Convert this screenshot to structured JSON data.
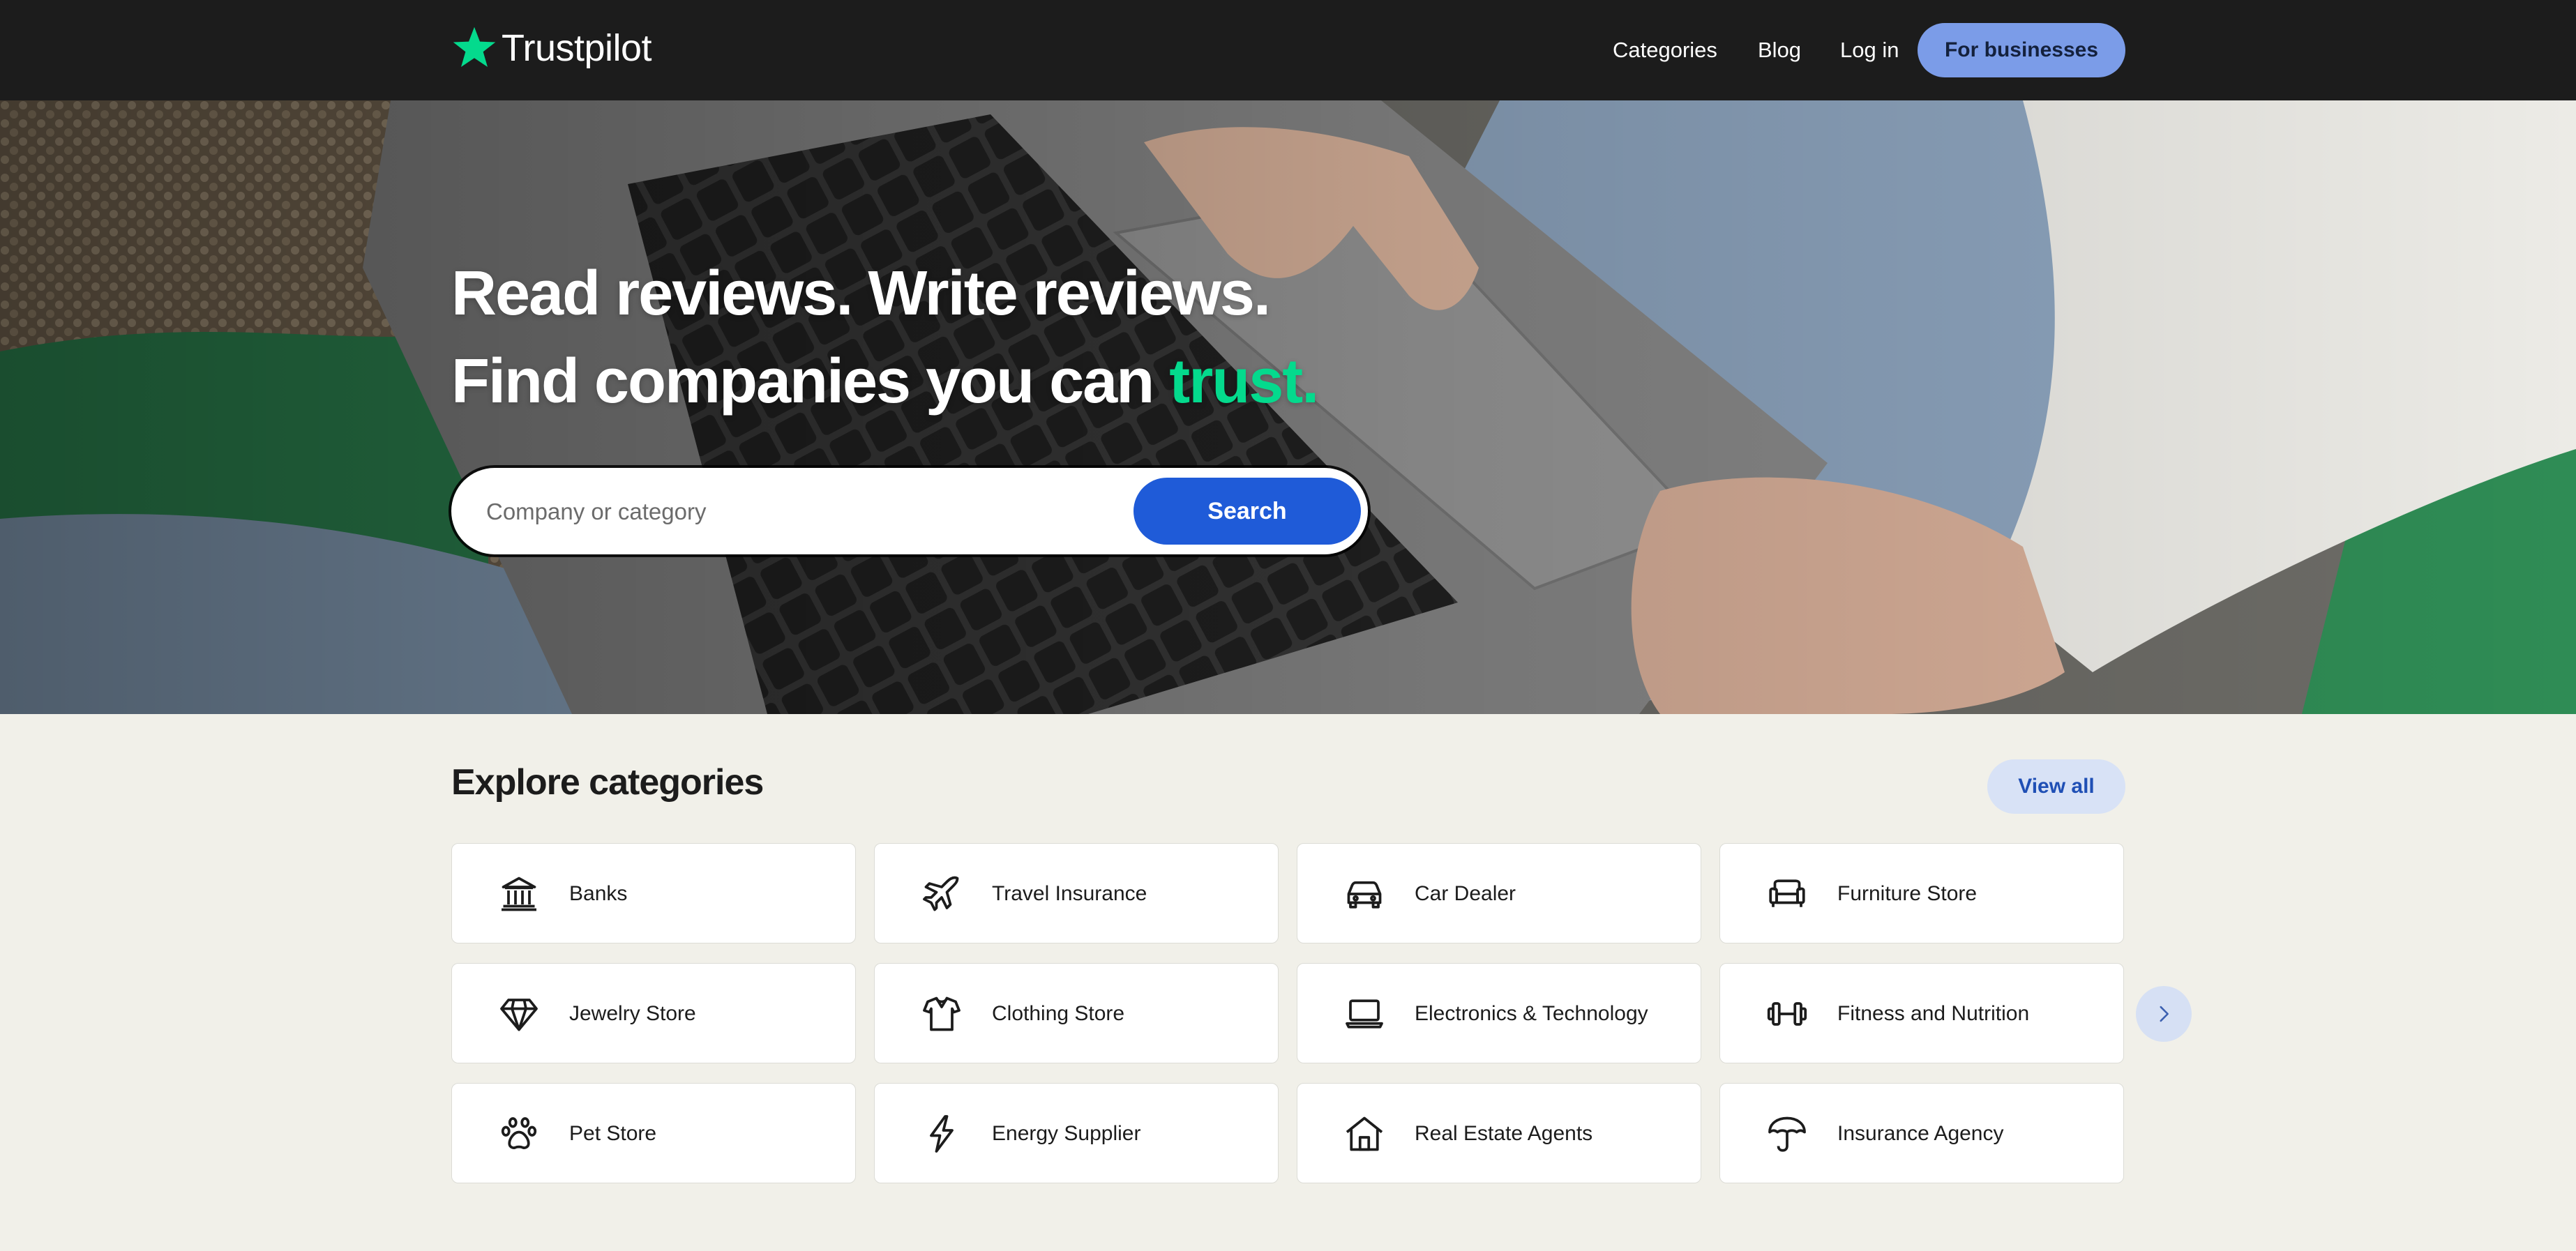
{
  "header": {
    "logo_text": "Trustpilot",
    "nav": {
      "categories": "Categories",
      "blog": "Blog",
      "login": "Log in"
    },
    "for_businesses": "For businesses"
  },
  "hero": {
    "line1": "Read reviews. Write reviews.",
    "line2_prefix": "Find companies you can ",
    "line2_accent": "trust.",
    "search_placeholder": "Company or category",
    "search_button": "Search"
  },
  "categories": {
    "title": "Explore categories",
    "view_all": "View all",
    "items": [
      {
        "label": "Banks",
        "icon": "bank-icon"
      },
      {
        "label": "Travel Insurance",
        "icon": "airplane-icon"
      },
      {
        "label": "Car Dealer",
        "icon": "car-icon"
      },
      {
        "label": "Furniture Store",
        "icon": "sofa-icon"
      },
      {
        "label": "Jewelry Store",
        "icon": "diamond-icon"
      },
      {
        "label": "Clothing Store",
        "icon": "shirt-icon"
      },
      {
        "label": "Electronics & Technology",
        "icon": "laptop-icon"
      },
      {
        "label": "Fitness and Nutrition",
        "icon": "dumbbell-icon"
      },
      {
        "label": "Pet Store",
        "icon": "paw-icon"
      },
      {
        "label": "Energy Supplier",
        "icon": "lightning-icon"
      },
      {
        "label": "Real Estate Agents",
        "icon": "house-icon"
      },
      {
        "label": "Insurance Agency",
        "icon": "umbrella-icon"
      }
    ]
  },
  "colors": {
    "header_bg": "#1c1c1c",
    "page_bg": "#f1f0e9",
    "brand_green": "#04da8d",
    "search_blue": "#1f5bd8",
    "business_button": "#7b9ce8"
  }
}
